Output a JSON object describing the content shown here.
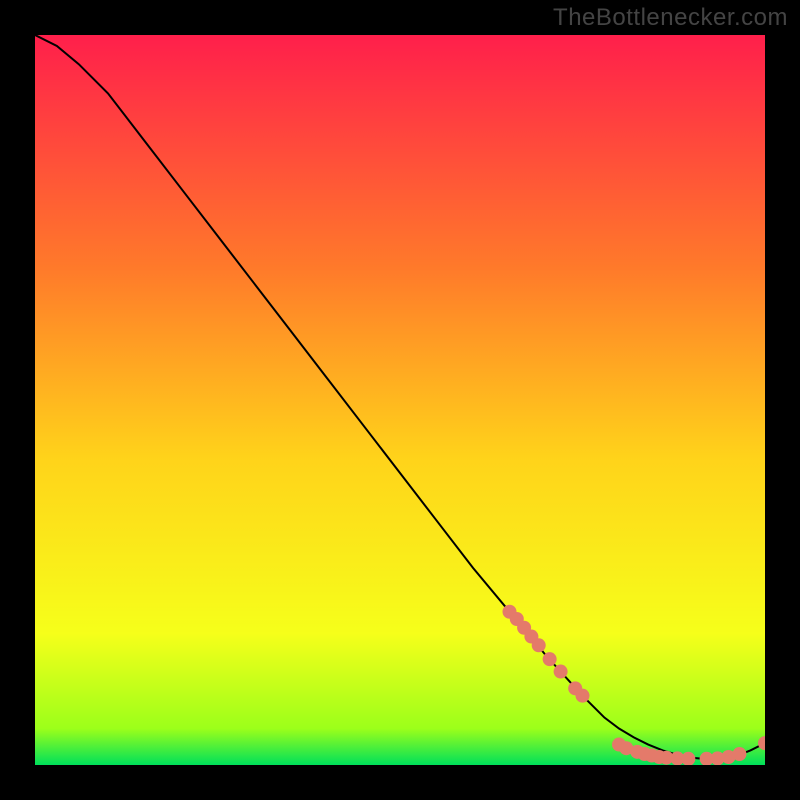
{
  "watermark": "TheBottlenecker.com",
  "chart_data": {
    "type": "line",
    "title": "",
    "xlabel": "",
    "ylabel": "",
    "xlim": [
      0,
      100
    ],
    "ylim": [
      0,
      100
    ],
    "gradient_colors": {
      "top": "#ff1f4b",
      "upper_mid": "#ff7a2a",
      "mid": "#ffd31a",
      "lower_mid": "#f6ff1a",
      "near_bottom": "#9cff1a",
      "bottom": "#00e05a"
    },
    "line_color": "#000000",
    "marker_color": "#e47a6a",
    "series": [
      {
        "name": "bottleneck-curve",
        "x": [
          0,
          3,
          6,
          10,
          15,
          20,
          25,
          30,
          35,
          40,
          45,
          50,
          55,
          60,
          65,
          70,
          75,
          78,
          80,
          82,
          84,
          86,
          88,
          90,
          92,
          94,
          96,
          98,
          100
        ],
        "y": [
          100,
          98.5,
          96,
          92,
          85.5,
          79,
          72.5,
          66,
          59.5,
          53,
          46.5,
          40,
          33.5,
          27,
          21,
          15,
          9.5,
          6.5,
          5,
          3.8,
          2.8,
          2,
          1.4,
          1,
          0.8,
          0.8,
          1.2,
          2,
          3
        ]
      }
    ],
    "markers": [
      {
        "x": 65,
        "y": 21
      },
      {
        "x": 66,
        "y": 20
      },
      {
        "x": 67,
        "y": 18.8
      },
      {
        "x": 68,
        "y": 17.6
      },
      {
        "x": 69,
        "y": 16.4
      },
      {
        "x": 70.5,
        "y": 14.5
      },
      {
        "x": 72,
        "y": 12.8
      },
      {
        "x": 74,
        "y": 10.5
      },
      {
        "x": 75,
        "y": 9.5
      },
      {
        "x": 80,
        "y": 2.8
      },
      {
        "x": 81,
        "y": 2.3
      },
      {
        "x": 82.5,
        "y": 1.8
      },
      {
        "x": 83.5,
        "y": 1.5
      },
      {
        "x": 84.5,
        "y": 1.3
      },
      {
        "x": 85.5,
        "y": 1.1
      },
      {
        "x": 86.5,
        "y": 1
      },
      {
        "x": 88,
        "y": 0.9
      },
      {
        "x": 89.5,
        "y": 0.85
      },
      {
        "x": 92,
        "y": 0.85
      },
      {
        "x": 93.5,
        "y": 0.9
      },
      {
        "x": 95,
        "y": 1.1
      },
      {
        "x": 96.5,
        "y": 1.5
      },
      {
        "x": 100,
        "y": 3
      }
    ]
  }
}
